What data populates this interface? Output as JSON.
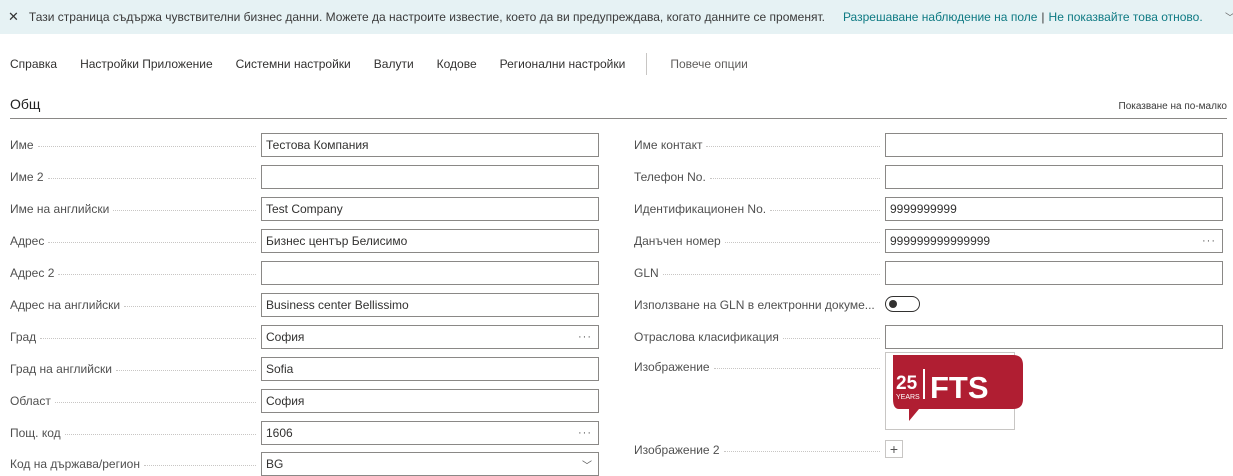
{
  "banner": {
    "message": "Тази страница съдържа чувствителни бизнес данни. Можете да настроите известие, което да ви предупреждава, когато данните се променят.",
    "link_allow": "Разрешаване наблюдение на поле",
    "separator": "|",
    "link_dismiss": "Не показвайте това отново."
  },
  "menu": {
    "items": [
      "Справка",
      "Настройки Приложение",
      "Системни настройки",
      "Валути",
      "Кодове",
      "Регионални настройки"
    ],
    "more": "Повече опции"
  },
  "section": {
    "title": "Общ",
    "show_less": "Показване на по-малко"
  },
  "left_fields": [
    {
      "label": "Име",
      "value": "Тестова Компания"
    },
    {
      "label": "Име 2",
      "value": ""
    },
    {
      "label": "Име на английски",
      "value": "Test Company"
    },
    {
      "label": "Адрес",
      "value": "Бизнес център Белисимо"
    },
    {
      "label": "Адрес 2",
      "value": ""
    },
    {
      "label": "Адрес на английски",
      "value": "Business center Bellissimo"
    },
    {
      "label": "Град",
      "value": "София"
    },
    {
      "label": "Град на английски",
      "value": "Sofia"
    },
    {
      "label": "Област",
      "value": "София"
    },
    {
      "label": "Пощ. код",
      "value": "1606"
    },
    {
      "label": "Код на държава/регион",
      "value": "BG"
    }
  ],
  "right_fields": [
    {
      "label": "Име контакт",
      "value": ""
    },
    {
      "label": "Телефон No.",
      "value": ""
    },
    {
      "label": "Идентификационен No.",
      "value": "9999999999"
    },
    {
      "label": "Данъчен номер",
      "value": "999999999999999"
    },
    {
      "label": "GLN",
      "value": ""
    },
    {
      "label": "Използване на GLN в електронни докуме...",
      "toggle": false
    },
    {
      "label": "Отраслова класификация",
      "value": ""
    },
    {
      "label": "Изображение"
    },
    {
      "label": "Изображение 2"
    }
  ],
  "logo": {
    "line1": "25",
    "line2": "YEARS",
    "brand": "FTS",
    "color": "#b01e32"
  },
  "colors": {
    "banner_bg": "#e6f2f4",
    "link": "#0e7a83",
    "input_border": "#8a8886"
  }
}
